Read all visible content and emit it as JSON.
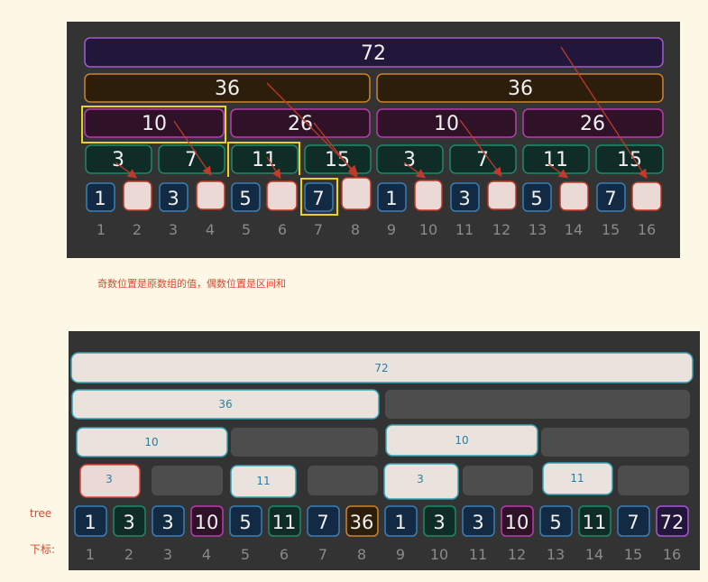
{
  "top_diagram": {
    "level1": [
      "72"
    ],
    "level2": [
      "36",
      "36"
    ],
    "level3": [
      "10",
      "26",
      "10",
      "26"
    ],
    "level4": [
      "3",
      "7",
      "11",
      "15",
      "3",
      "7",
      "11",
      "15"
    ],
    "leaves": [
      "1",
      "",
      "3",
      "",
      "5",
      "",
      "7",
      "",
      "1",
      "",
      "3",
      "",
      "5",
      "",
      "7",
      ""
    ],
    "indices": [
      "1",
      "2",
      "3",
      "4",
      "5",
      "6",
      "7",
      "8",
      "9",
      "10",
      "11",
      "12",
      "13",
      "14",
      "15",
      "16"
    ]
  },
  "caption": "奇数位置是原数组的值，偶数位置是区间和",
  "bottom_diagram": {
    "level1": [
      "72"
    ],
    "level2": [
      "36",
      ""
    ],
    "level3": [
      "10",
      "",
      "10",
      ""
    ],
    "level4": [
      "3",
      "",
      "11",
      "",
      "3",
      "",
      "11",
      ""
    ],
    "tree_label": "tree",
    "index_label": "下标:",
    "tree": [
      "1",
      "3",
      "3",
      "10",
      "5",
      "11",
      "7",
      "36",
      "1",
      "3",
      "3",
      "10",
      "5",
      "11",
      "7",
      "72"
    ],
    "indices": [
      "1",
      "2",
      "3",
      "4",
      "5",
      "6",
      "7",
      "8",
      "9",
      "10",
      "11",
      "12",
      "13",
      "14",
      "15",
      "16"
    ]
  },
  "colors": {
    "panel": "#333333",
    "purple": "#a25bd6",
    "orange": "#c9852b",
    "magenta": "#b83dac",
    "green": "#1f8a66",
    "blue": "#3a7fb7",
    "red_arrow": "#c0392b",
    "yellow_highlight": "#e7d322",
    "sketch_box": "#e9e2dd",
    "sketch_border": "#33a1b5"
  }
}
